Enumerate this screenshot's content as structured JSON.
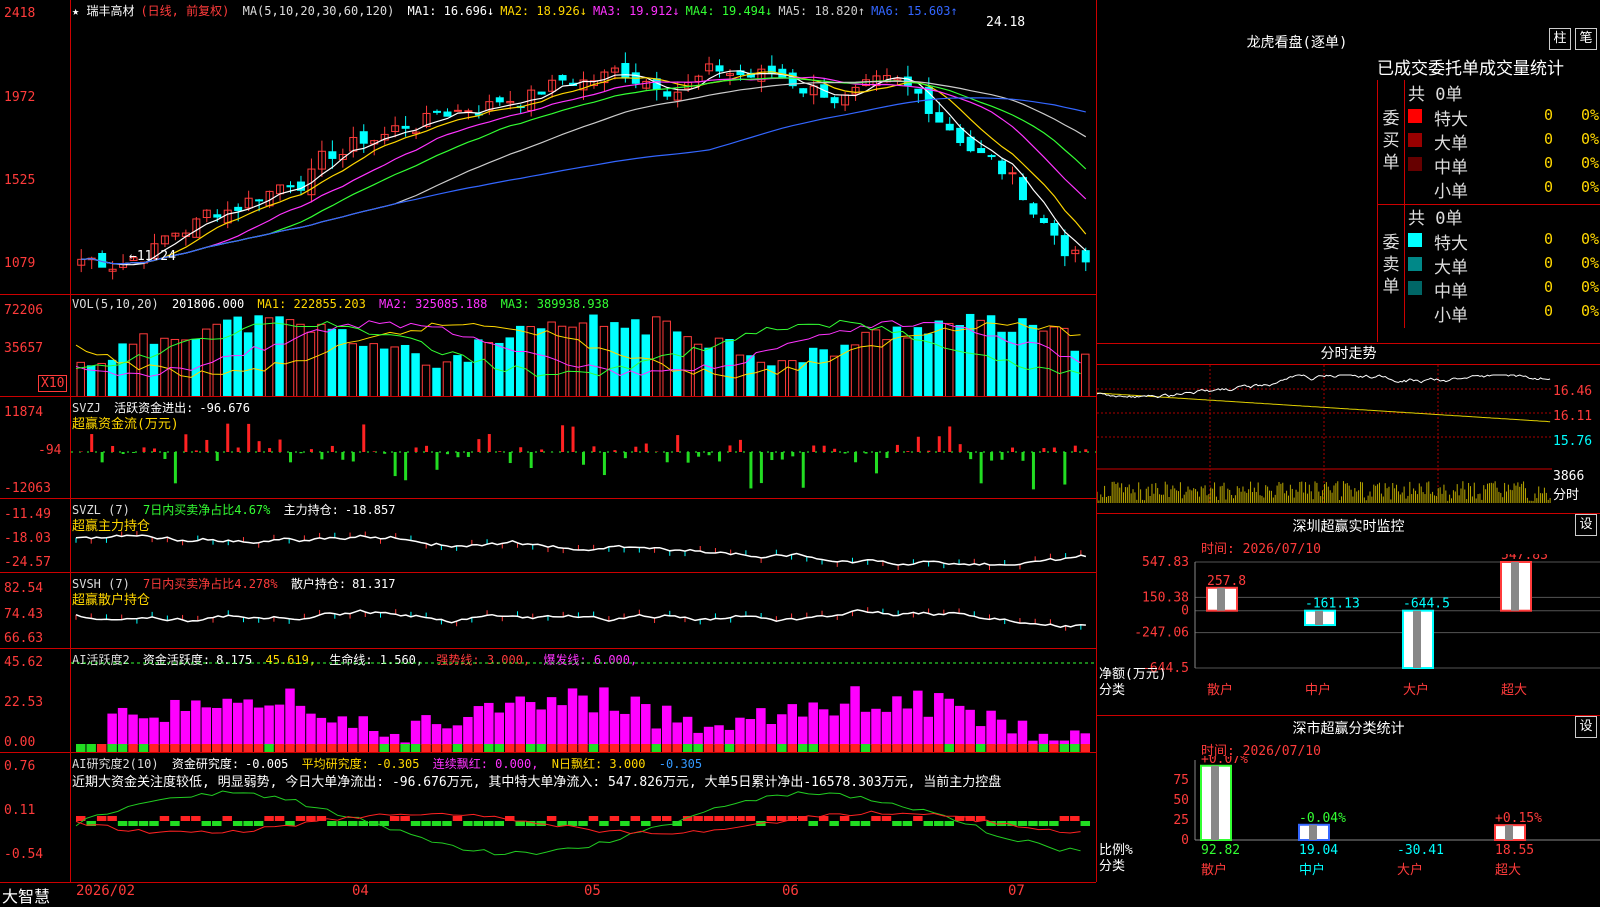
{
  "stock": {
    "name": "★ 瑞丰高材",
    "mode": "(日线, 前复权)"
  },
  "main_header": {
    "ma_label": "MA(5,10,20,30,60,120)",
    "items": [
      {
        "k": "MA1:",
        "v": "16.696",
        "arrow": "↓",
        "color": "#ffffff"
      },
      {
        "k": "MA2:",
        "v": "18.926",
        "arrow": "↓",
        "color": "#ffd700"
      },
      {
        "k": "MA3:",
        "v": "19.912",
        "arrow": "↓",
        "color": "#ff33ff"
      },
      {
        "k": "MA4:",
        "v": "19.494",
        "arrow": "↓",
        "color": "#33ff33"
      },
      {
        "k": "MA5:",
        "v": "18.820",
        "arrow": "↑",
        "color": "#cccccc"
      },
      {
        "k": "MA6:",
        "v": "15.603",
        "arrow": "↑",
        "color": "#3366ff"
      }
    ],
    "high_mark": "24.18",
    "low_mark": "←11.24"
  },
  "main_axis": [
    "2418",
    "1972",
    "1525",
    "1079"
  ],
  "vol_header": {
    "label": "VOL(5,10,20)",
    "value": "201806.000",
    "ma1": "MA1: 222855.203",
    "ma2": "MA2: 325085.188",
    "ma3": "MA3: 389938.938"
  },
  "vol_axis": [
    "72206",
    "35657",
    "X10"
  ],
  "svzj": {
    "title": "SVZJ",
    "name": "活跃资金进出:",
    "value": "-96.676",
    "sub": "超赢资金流(万元)",
    "axis": [
      "11874",
      "-94",
      "-12063"
    ]
  },
  "svzl": {
    "title": "SVZL (7)",
    "desc": "7日内买卖净占比4.67%",
    "name": "主力持仓:",
    "value": "-18.857",
    "sub": "超赢主力持仓",
    "axis": [
      "-11.49",
      "-18.03",
      "-24.57"
    ]
  },
  "svsh": {
    "title": "SVSH (7)",
    "desc": "7日内买卖净占比4.278%",
    "name": "散户持仓:",
    "value": "81.317",
    "sub": "超赢散户持仓",
    "axis": [
      "82.54",
      "74.43",
      "66.63"
    ]
  },
  "ai1": {
    "title": "AI活跃度2",
    "name": "资金活跃度:",
    "value": "8.175",
    "v2": "45.619,",
    "life": "生命线: 1.560,",
    "strong": "强势线: 3.000,",
    "burst": "爆发线: 6.000,",
    "axis": [
      "45.62",
      "22.53",
      "0.00"
    ]
  },
  "ai2": {
    "title": "AI研究度2(10)",
    "name": "资金研究度:",
    "value": "-0.005",
    "avg": "平均研究度: -0.305",
    "lianxu": "连续飘红: 0.000,",
    "nri": "N日飘红: 3.000",
    "last": "-0.305",
    "desc": "近期大资金关注度较低, 明显弱势, 今日大单净流出: -96.676万元, 其中特大单净流入: 547.826万元, 大单5日累计净出-16578.303万元, 当前主力控盘",
    "axis": [
      "0.76",
      "0.11",
      "-0.54"
    ]
  },
  "bottom": {
    "brand": "大智慧",
    "dates": [
      "2026/02",
      "04",
      "05",
      "06",
      "07"
    ]
  },
  "lhb": {
    "title": "龙虎看盘(逐单)",
    "btn1": "柱",
    "btn2": "笔",
    "tabs": "已成交委托单成交量统计",
    "buy": {
      "label": "委买单",
      "total": "共 0单",
      "rows": [
        {
          "name": "特大",
          "v": "0",
          "p": "0%",
          "color": "#ff0000"
        },
        {
          "name": "大单",
          "v": "0",
          "p": "0%",
          "color": "#990000"
        },
        {
          "name": "中单",
          "v": "0",
          "p": "0%",
          "color": "#660000"
        },
        {
          "name": "小单",
          "v": "0",
          "p": "0%",
          "color": "#000000"
        }
      ]
    },
    "sell": {
      "label": "委卖单",
      "total": "共 0单",
      "rows": [
        {
          "name": "特大",
          "v": "0",
          "p": "0%",
          "color": "#00ffff"
        },
        {
          "name": "大单",
          "v": "0",
          "p": "0%",
          "color": "#008888"
        },
        {
          "name": "中单",
          "v": "0",
          "p": "0%",
          "color": "#006666"
        },
        {
          "name": "小单",
          "v": "0",
          "p": "0%",
          "color": "#000000"
        }
      ]
    }
  },
  "fenshi": {
    "title": "分时走势",
    "axis": [
      "16.46",
      "16.11",
      "15.76"
    ],
    "vol": "3866",
    "unit": "分时"
  },
  "sz_monitor": {
    "title": "深圳超赢实时监控",
    "btn": "设",
    "time": "时间: 2026/07/10",
    "axis": [
      "547.83",
      "150.38",
      "0",
      "-247.06",
      "-644.5"
    ],
    "ylabel": "净额(万元)",
    "xlabel": "分类",
    "bars": [
      {
        "name": "散户",
        "value": 257.8,
        "label": "257.8"
      },
      {
        "name": "中户",
        "value": -161.13,
        "label": "-161.13"
      },
      {
        "name": "大户",
        "value": -644.5,
        "label": "-644.5"
      },
      {
        "name": "超大",
        "value": 547.83,
        "label": "547.83"
      }
    ]
  },
  "sz_class": {
    "title": "深市超赢分类统计",
    "btn": "设",
    "time": "时间: 2026/07/10",
    "axis": [
      "75",
      "50",
      "25",
      "0"
    ],
    "ylabel": "比例%",
    "xlabel": "分类",
    "bars": [
      {
        "name": "散户",
        "value": 92.82,
        "label": "92.82",
        "top": "+0.07%"
      },
      {
        "name": "中户",
        "value": 19.04,
        "label": "19.04",
        "top": "-0.04%"
      },
      {
        "name": "大户",
        "value": -30.41,
        "label": "-30.41",
        "top": ""
      },
      {
        "name": "超大",
        "value": 18.55,
        "label": "18.55",
        "top": "+0.15%"
      }
    ]
  }
}
